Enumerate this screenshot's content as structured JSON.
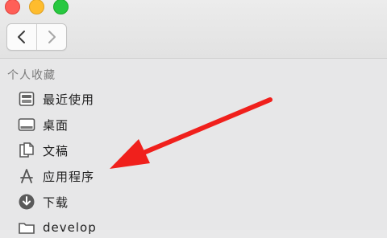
{
  "sidebar": {
    "section_title": "个人收藏",
    "items": [
      {
        "label": "最近使用"
      },
      {
        "label": "桌面"
      },
      {
        "label": "文稿"
      },
      {
        "label": "应用程序"
      },
      {
        "label": "下载"
      },
      {
        "label": "develop"
      }
    ]
  },
  "colors": {
    "close": "#ff5f57",
    "minimize": "#febc2e",
    "zoom": "#28c840",
    "annotation_arrow": "#f0201c"
  },
  "icons": [
    "chevron-left-icon",
    "chevron-right-icon",
    "recents-icon",
    "desktop-icon",
    "documents-icon",
    "applications-icon",
    "downloads-icon",
    "folder-icon"
  ]
}
